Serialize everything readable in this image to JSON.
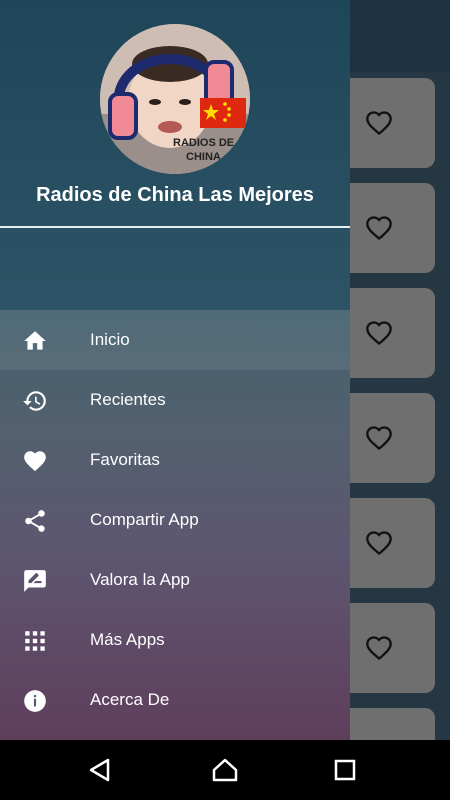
{
  "drawer": {
    "title": "Radios de China Las Mejores",
    "avatar_text_line1": "RADIOS DE",
    "avatar_text_line2": "CHINA",
    "items": [
      {
        "label": "Inicio",
        "icon": "home-icon",
        "active": true
      },
      {
        "label": "Recientes",
        "icon": "history-icon"
      },
      {
        "label": "Favoritas",
        "icon": "heart-icon"
      },
      {
        "label": "Compartir App",
        "icon": "share-icon"
      },
      {
        "label": "Valora la App",
        "icon": "rate-review-icon"
      },
      {
        "label": "Más Apps",
        "icon": "apps-grid-icon"
      },
      {
        "label": "Acerca De",
        "icon": "info-icon"
      }
    ]
  },
  "background_list": {
    "card_count": 6,
    "card_icon": "heart-outline-icon"
  },
  "colors": {
    "drawer_top": "#23475a",
    "drawer_bottom": "#5f3e5c",
    "card": "#6f6f6f",
    "flag_red": "#de2910",
    "flag_yellow": "#ffde00"
  },
  "navbar": {
    "back_icon": "back-triangle-icon",
    "home_icon": "home-outline-icon",
    "recents_icon": "recents-square-icon"
  }
}
